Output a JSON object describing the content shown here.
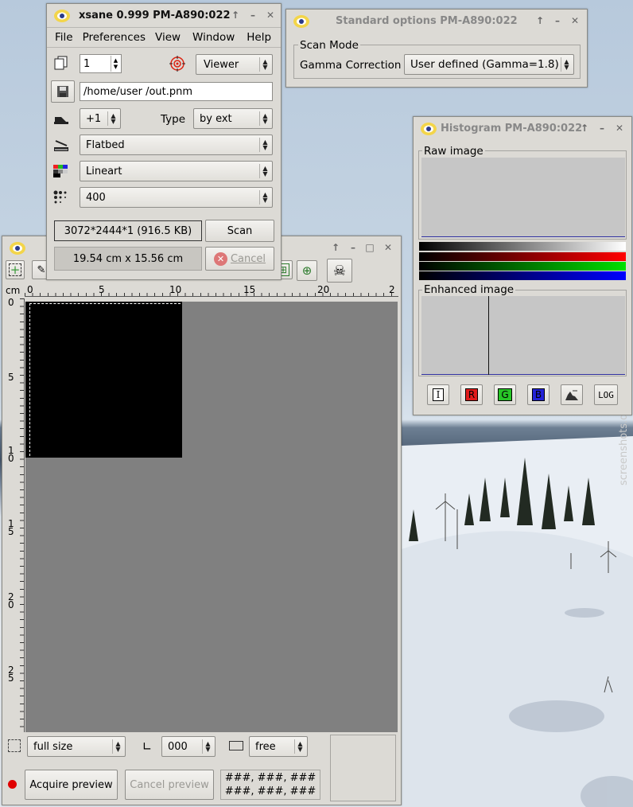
{
  "xsane": {
    "title": "xsane 0.999 PM-A890:022",
    "menu": [
      "File",
      "Preferences",
      "View",
      "Window",
      "Help"
    ],
    "copies": "1",
    "target_mode": "Viewer",
    "filename": "/home/user /out.pnm",
    "step": "+1",
    "type_label": "Type",
    "type_value": "by ext",
    "source": "Flatbed",
    "scan_mode": "Lineart",
    "resolution": "400",
    "image_info": "3072*2444*1 (916.5 KB)",
    "image_size": "19.54 cm x 15.56 cm",
    "scan_label": "Scan",
    "cancel_label": "Cancel"
  },
  "options": {
    "title": "Standard options PM-A890:022",
    "group": "Scan Mode",
    "gamma_label": "Gamma Correction",
    "gamma_value": "User defined (Gamma=1.8)"
  },
  "histogram": {
    "title": "Histogram PM-A890:022",
    "raw_label": "Raw image",
    "enhanced_label": "Enhanced image",
    "buttons": [
      "I",
      "R",
      "G",
      "B",
      "LOG"
    ],
    "colors": {
      "R": "#e01b1b",
      "G": "#27c627",
      "B": "#2323d8"
    }
  },
  "preview": {
    "unit": "cm",
    "hruler": [
      "0",
      "5",
      "10",
      "15",
      "20",
      "2"
    ],
    "vruler": [
      "0",
      "5",
      "1\n0",
      "1\n5",
      "2\n0",
      "2\n5"
    ],
    "size_value": "full size",
    "rotation_value": "000",
    "ratio_value": "free",
    "acquire_label": "Acquire preview",
    "cancel_preview_label": "Cancel preview",
    "pixel_readout_1": "###, ###, ###",
    "pixel_readout_2": "###, ###, ###"
  },
  "watermark": "screenshots.debian.net"
}
